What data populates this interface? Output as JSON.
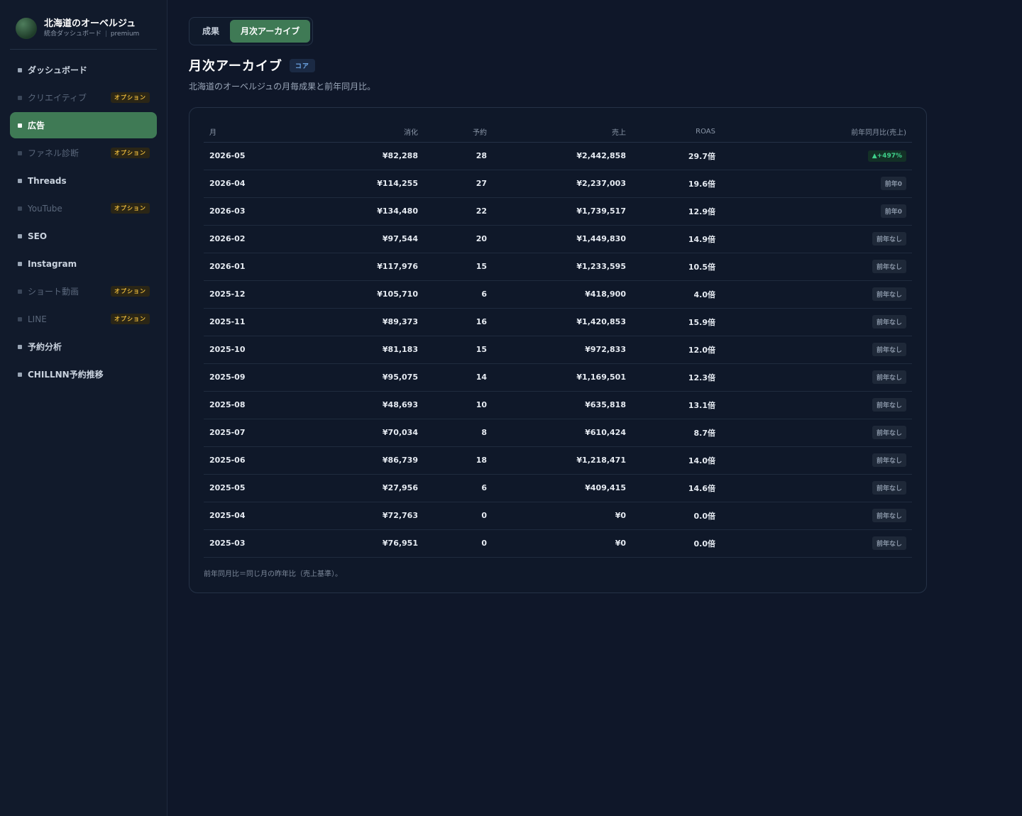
{
  "brand": {
    "title": "北海道のオーベルジュ",
    "subtitle": "統合ダッシュボード",
    "separator": "|",
    "tier": "premium"
  },
  "sidebar": {
    "items": [
      {
        "label": "ダッシュボード",
        "state": "normal",
        "badge": ""
      },
      {
        "label": "クリエイティブ",
        "state": "disabled",
        "badge": "オプション"
      },
      {
        "label": "広告",
        "state": "active",
        "badge": ""
      },
      {
        "label": "ファネル診断",
        "state": "disabled",
        "badge": "オプション"
      },
      {
        "label": "Threads",
        "state": "normal",
        "badge": ""
      },
      {
        "label": "YouTube",
        "state": "disabled",
        "badge": "オプション"
      },
      {
        "label": "SEO",
        "state": "normal",
        "badge": ""
      },
      {
        "label": "Instagram",
        "state": "normal",
        "badge": ""
      },
      {
        "label": "ショート動画",
        "state": "disabled",
        "badge": "オプション"
      },
      {
        "label": "LINE",
        "state": "disabled",
        "badge": "オプション"
      },
      {
        "label": "予約分析",
        "state": "normal",
        "badge": ""
      },
      {
        "label": "CHILLNN予約推移",
        "state": "normal",
        "badge": ""
      }
    ]
  },
  "tabs": [
    {
      "label": "成果",
      "active": false
    },
    {
      "label": "月次アーカイブ",
      "active": true
    }
  ],
  "page": {
    "title": "月次アーカイブ",
    "badge": "コア",
    "subtitle": "北海道のオーベルジュの月毎成果と前年同月比。"
  },
  "table": {
    "headers": [
      "月",
      "消化",
      "予約",
      "売上",
      "ROAS",
      "前年同月比(売上)"
    ],
    "rows": [
      {
        "month": "2026-05",
        "spend": "¥82,288",
        "bookings": "28",
        "sales": "¥2,442,858",
        "roas": "29.7倍",
        "yoy": "▲+497%",
        "yoy_type": "up"
      },
      {
        "month": "2026-04",
        "spend": "¥114,255",
        "bookings": "27",
        "sales": "¥2,237,003",
        "roas": "19.6倍",
        "yoy": "前年0",
        "yoy_type": "neutral"
      },
      {
        "month": "2026-03",
        "spend": "¥134,480",
        "bookings": "22",
        "sales": "¥1,739,517",
        "roas": "12.9倍",
        "yoy": "前年0",
        "yoy_type": "neutral"
      },
      {
        "month": "2026-02",
        "spend": "¥97,544",
        "bookings": "20",
        "sales": "¥1,449,830",
        "roas": "14.9倍",
        "yoy": "前年なし",
        "yoy_type": "neutral"
      },
      {
        "month": "2026-01",
        "spend": "¥117,976",
        "bookings": "15",
        "sales": "¥1,233,595",
        "roas": "10.5倍",
        "yoy": "前年なし",
        "yoy_type": "neutral"
      },
      {
        "month": "2025-12",
        "spend": "¥105,710",
        "bookings": "6",
        "sales": "¥418,900",
        "roas": "4.0倍",
        "yoy": "前年なし",
        "yoy_type": "neutral"
      },
      {
        "month": "2025-11",
        "spend": "¥89,373",
        "bookings": "16",
        "sales": "¥1,420,853",
        "roas": "15.9倍",
        "yoy": "前年なし",
        "yoy_type": "neutral"
      },
      {
        "month": "2025-10",
        "spend": "¥81,183",
        "bookings": "15",
        "sales": "¥972,833",
        "roas": "12.0倍",
        "yoy": "前年なし",
        "yoy_type": "neutral"
      },
      {
        "month": "2025-09",
        "spend": "¥95,075",
        "bookings": "14",
        "sales": "¥1,169,501",
        "roas": "12.3倍",
        "yoy": "前年なし",
        "yoy_type": "neutral"
      },
      {
        "month": "2025-08",
        "spend": "¥48,693",
        "bookings": "10",
        "sales": "¥635,818",
        "roas": "13.1倍",
        "yoy": "前年なし",
        "yoy_type": "neutral"
      },
      {
        "month": "2025-07",
        "spend": "¥70,034",
        "bookings": "8",
        "sales": "¥610,424",
        "roas": "8.7倍",
        "yoy": "前年なし",
        "yoy_type": "neutral"
      },
      {
        "month": "2025-06",
        "spend": "¥86,739",
        "bookings": "18",
        "sales": "¥1,218,471",
        "roas": "14.0倍",
        "yoy": "前年なし",
        "yoy_type": "neutral"
      },
      {
        "month": "2025-05",
        "spend": "¥27,956",
        "bookings": "6",
        "sales": "¥409,415",
        "roas": "14.6倍",
        "yoy": "前年なし",
        "yoy_type": "neutral"
      },
      {
        "month": "2025-04",
        "spend": "¥72,763",
        "bookings": "0",
        "sales": "¥0",
        "roas": "0.0倍",
        "yoy": "前年なし",
        "yoy_type": "neutral"
      },
      {
        "month": "2025-03",
        "spend": "¥76,951",
        "bookings": "0",
        "sales": "¥0",
        "roas": "0.0倍",
        "yoy": "前年なし",
        "yoy_type": "neutral"
      }
    ],
    "footnote": "前年同月比＝同じ月の昨年比（売上基準）。"
  },
  "colors": {
    "accent": "#3f7a55",
    "background": "#0f1729",
    "option_badge": "#e8b83a",
    "positive": "#3ed08a"
  }
}
